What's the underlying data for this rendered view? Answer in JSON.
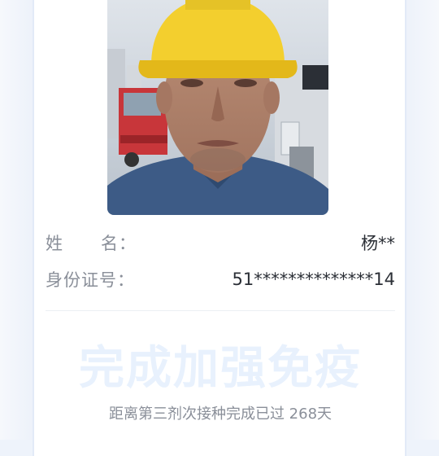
{
  "person": {
    "name_label": "姓      名：",
    "name_value": "杨**",
    "id_label": "身份证号：",
    "id_value": "51**************14"
  },
  "status": {
    "title": "完成加强免疫",
    "subtitle": "距离第三剂次接种完成已过 268天"
  },
  "colors": {
    "page_bg": "#eef3fb",
    "top_gradient": "#b8d0f3",
    "label_text": "#8a8f99",
    "value_text": "#2b2f36",
    "status_title": "#e8f1fd",
    "helmet": "#f3cf2e"
  }
}
